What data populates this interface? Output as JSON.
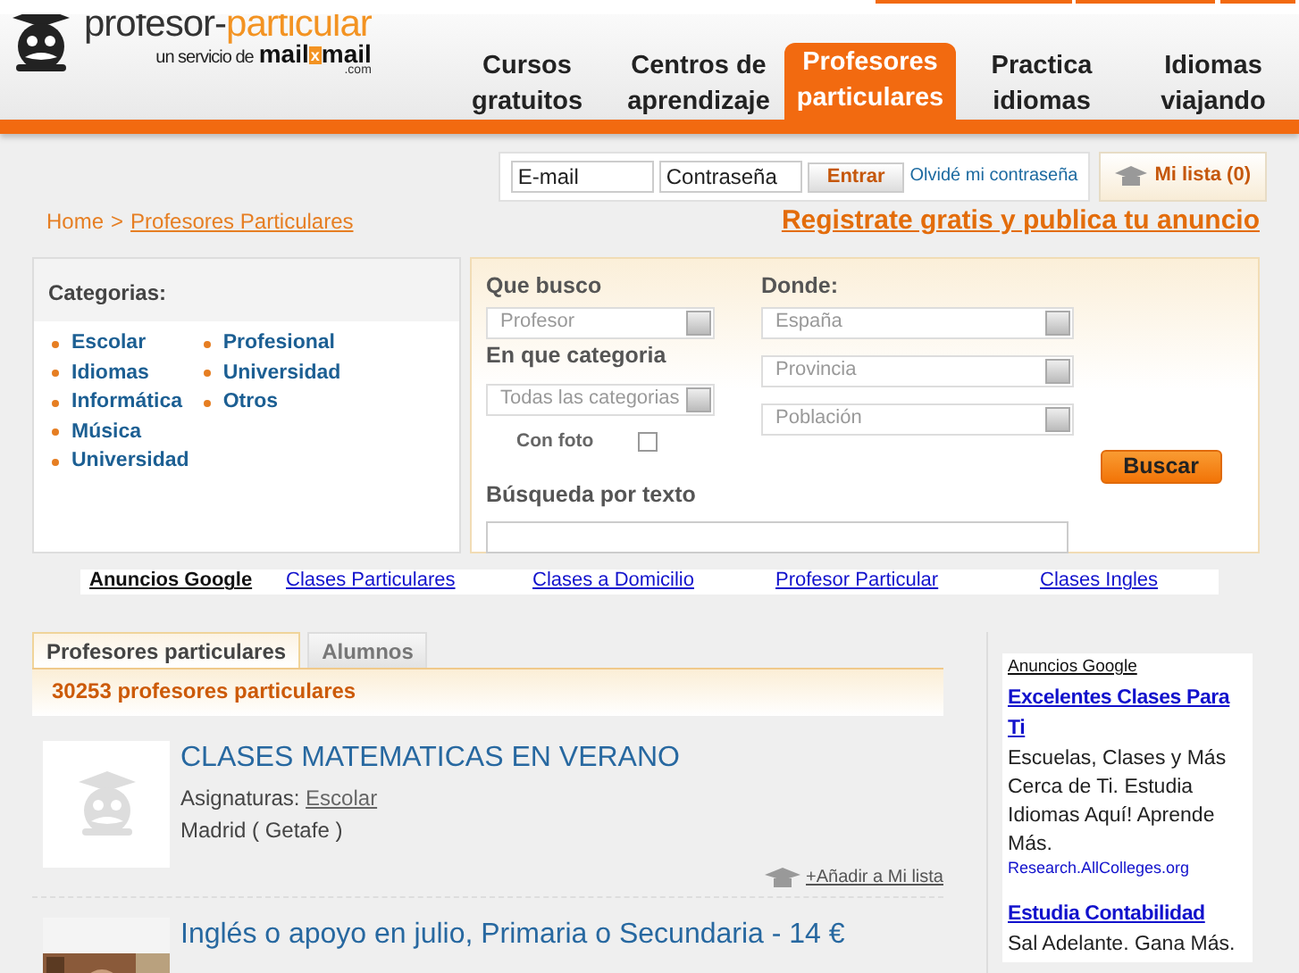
{
  "header": {
    "logo": {
      "name_parts": [
        "profesor-",
        "particular"
      ],
      "tagline": "un servicio de",
      "brand_parts": [
        "mail",
        "x",
        "mail"
      ],
      "domain": ".com"
    },
    "nav": [
      {
        "label": "Cursos gratuitos",
        "selected": false
      },
      {
        "label": "Centros de aprendizaje",
        "selected": false
      },
      {
        "label": "Profesores particulares",
        "selected": true
      },
      {
        "label": "Practica idiomas",
        "selected": false
      },
      {
        "label": "Idiomas viajando",
        "selected": false
      }
    ]
  },
  "login": {
    "email_placeholder": "E-mail",
    "password_placeholder": "Contraseña",
    "submit": "Entrar",
    "forgot_link": "Olvidé mi contraseña"
  },
  "my_list": "Mi lista (0)",
  "breadcrumb": {
    "items": [
      "Home",
      "Profesores Particulares"
    ],
    "separator": ">"
  },
  "register_link": "Registrate gratis y publica tu anuncio",
  "categories": {
    "title": "Categorias:",
    "columns": [
      [
        "Escolar",
        "Idiomas",
        "Informática",
        "Música",
        "Universidad"
      ],
      [
        "Profesional",
        "Universidad",
        "Otros"
      ]
    ]
  },
  "search": {
    "what_label": "Que busco",
    "what_value": "Profesor",
    "category_label": "En que categoria",
    "category_value": "Todas las categorias",
    "photo_label": "Con foto",
    "photo_checked": false,
    "where_label": "Donde:",
    "where_values": [
      "España",
      "Provincia",
      "Población"
    ],
    "text_label": "Búsqueda por texto",
    "button": "Buscar"
  },
  "ads_bar": {
    "label": "Anuncios Google",
    "links": [
      "Clases Particulares",
      "Clases a Domicilio",
      "Profesor Particular",
      "Clases Ingles"
    ]
  },
  "results": {
    "tabs": [
      {
        "label": "Profesores particulares",
        "selected": true
      },
      {
        "label": "Alumnos",
        "selected": false
      }
    ],
    "count": "30253 profesores particulares",
    "items": [
      {
        "title": "CLASES MATEMATICAS EN VERANO",
        "subjects_label": "Asignaturas:",
        "subjects": [
          "Escolar"
        ],
        "location": "Madrid ( Getafe )",
        "add_link": "+Añadir a Mi lista",
        "kind": "placeholder"
      },
      {
        "title": "Inglés o apoyo en julio, Primaria o Secundaria - 14 €",
        "kind": "picture"
      }
    ]
  },
  "sidebar_ads": {
    "label": "Anuncios Google",
    "ads": [
      {
        "title": "Excelentes Clases Para Ti",
        "body": "Escuelas, Clases y Más Cerca de Ti. Estudia Idiomas Aquí! Aprende Más.",
        "url": "Research.AllColleges.org"
      },
      {
        "title": "Estudia Contabilidad",
        "body": "Sal Adelante. Gana Más."
      }
    ]
  }
}
